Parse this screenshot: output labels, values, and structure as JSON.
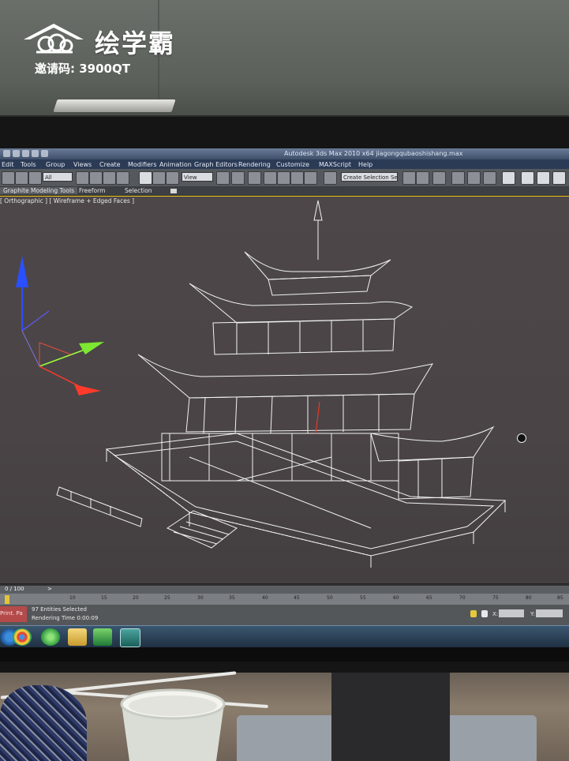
{
  "watermark": {
    "brand": "绘学霸",
    "invite": "邀请码: 3900QT",
    "logo_icon": "cloud-house-logo"
  },
  "app": {
    "title": "Autodesk 3ds Max 2010 x64     jiagongqubaoshishang.max",
    "menu": [
      "Edit",
      "Tools",
      "Group",
      "Views",
      "Create",
      "Modifiers",
      "Animation",
      "Graph Editors",
      "Rendering",
      "Customize",
      "MAXScript",
      "Help"
    ],
    "toolbar": {
      "filter_value": "All",
      "view_value": "View",
      "selection_set_placeholder": "Create Selection Set"
    },
    "ribbon_tabs": [
      "Graphite Modeling Tools",
      "Freeform",
      "Selection"
    ],
    "viewport_label": "[ Orthographic ] [ Wireframe + Edged Faces ]",
    "timeline": {
      "frame_counter": "0 / 100",
      "ticks": [
        "10",
        "15",
        "20",
        "25",
        "30",
        "35",
        "40",
        "45",
        "50",
        "55",
        "60",
        "65",
        "70",
        "75",
        "80",
        "85"
      ]
    },
    "status": {
      "script_label": "Print. Pa",
      "selection": "97 Entities Selected",
      "render_time": "Rendering Time  0:00:09",
      "x_label": "X:",
      "y_label": "Y:"
    },
    "taskbar_icons": [
      "start-orb-icon",
      "google-chrome-icon",
      "globe-app-icon",
      "file-explorer-icon",
      "photo-app-icon",
      "3ds-max-icon"
    ]
  },
  "colors": {
    "viewport_bg": "#4a4547",
    "wireframe": "#f2f2f2",
    "axis_z": "#2a4fff",
    "axis_y": "#9bff3a",
    "axis_x": "#ff3a2a",
    "active_border": "#f3c61d"
  }
}
